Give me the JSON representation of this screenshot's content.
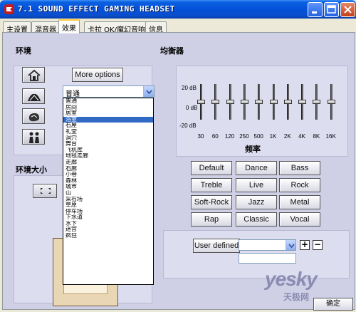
{
  "window": {
    "title": "7.1 SOUND EFFECT GAMING HEADSET",
    "buttons": {
      "minimize": "_",
      "maximize": "□",
      "close": "×"
    }
  },
  "tabs": [
    {
      "label": "主设置",
      "active": false
    },
    {
      "label": "混音器",
      "active": false
    },
    {
      "label": "效果",
      "active": true
    },
    {
      "label": "卡拉 OK/魔幻音响",
      "active": false
    },
    {
      "label": "信息",
      "active": false
    }
  ],
  "environment": {
    "title": "环境",
    "more_options_label": "More options",
    "selected": "普通",
    "options": [
      "普通",
      "房间",
      "居室",
      "浴室",
      "石屋",
      "礼堂",
      "洞穴",
      "舞台",
      "飞机库",
      "地毯走廊",
      "走廊",
      "石廊",
      "小巷",
      "森林",
      "城市",
      "山",
      "采石场",
      "草原",
      "停车场",
      "下水道",
      "水下",
      "迷宫",
      "疯狂"
    ],
    "highlighted_index": 3,
    "icons": [
      "house-icon",
      "concert-hall-icon",
      "brain-icon",
      "people-icon"
    ]
  },
  "environment_size": {
    "title": "环境大小",
    "toggle_icon": "expand-icon"
  },
  "equalizer": {
    "title": "均衡器",
    "scale_top": "20 dB",
    "scale_mid": "0 dB",
    "scale_bottom": "-20 dB",
    "axis_title": "频率",
    "bands": [
      "30",
      "60",
      "120",
      "250",
      "500",
      "1K",
      "2K",
      "4K",
      "8K",
      "16K"
    ],
    "band_levels_db": [
      0,
      0,
      0,
      0,
      0,
      0,
      0,
      0,
      0,
      0
    ],
    "presets": [
      "Default",
      "Dance",
      "Bass",
      "Treble",
      "Live",
      "Rock",
      "Soft-Rock",
      "Jazz",
      "Metal",
      "Rap",
      "Classic",
      "Vocal"
    ],
    "user_defined_label": "User defined",
    "user_defined_value": "",
    "user_defined_name": "",
    "plus_label": "+",
    "minus_label": "−"
  },
  "watermark": {
    "text": "yesky",
    "sub": "天极网"
  },
  "footer": {
    "ok_label": "确定"
  }
}
